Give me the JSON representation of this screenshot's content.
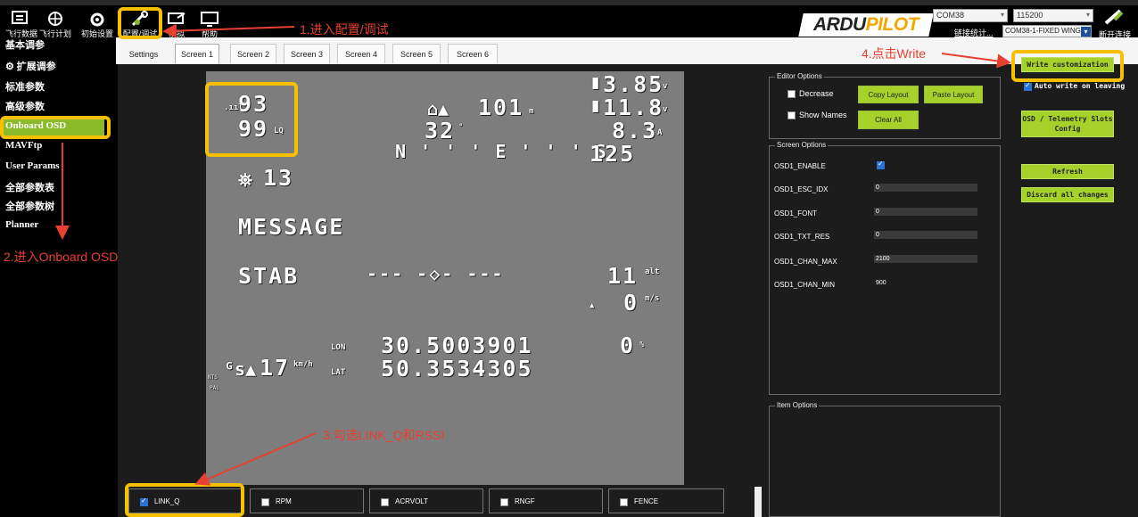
{
  "toolbar": {
    "items": [
      {
        "label": "飞行数据",
        "icon": "flight-data-icon"
      },
      {
        "label": "飞行计划",
        "icon": "flight-plan-icon"
      },
      {
        "label": "初始设置",
        "icon": "initial-setup-icon"
      },
      {
        "label": "配置/调试",
        "icon": "config-tuning-icon"
      },
      {
        "label": "模拟",
        "icon": "simulation-icon"
      },
      {
        "label": "帮助",
        "icon": "help-icon"
      }
    ],
    "logo_text_a": "ARDU",
    "logo_text_b": "PILOT",
    "port": "COM38",
    "baud": "115200",
    "link_stats": "链接统计...",
    "vehicle": "COM38-1-FIXED WING",
    "disconnect": "断开连接"
  },
  "sidebar": {
    "items": [
      "基本调参",
      "扩展调参",
      "标准参数",
      "高级参数",
      "Onboard OSD",
      "MAVFtp",
      "User Params",
      "全部参数表",
      "全部参数树",
      "Planner"
    ]
  },
  "tabs": [
    "Settings",
    "Screen 1",
    "Screen 2",
    "Screen 3",
    "Screen 4",
    "Screen 5",
    "Screen 6"
  ],
  "osd": {
    "rssi": "93",
    "link_q": "99",
    "batt1": "3.85",
    "batt1_unit": "v",
    "batt2": "11.8",
    "batt2_unit": "v",
    "home_dist": "101",
    "home_unit": "m",
    "heading": "32",
    "current": "8.3",
    "current_unit": "A",
    "compass": "N ' ' ' E ' ' ' S",
    "throttle": "125",
    "sats": "13",
    "message": "MESSAGE",
    "mode": "STAB",
    "horizon": "--- -◇- ---",
    "altitude": "11",
    "climb": "0",
    "lon_label": "LON",
    "lat_label": "LAT",
    "lon": "30.5003901",
    "lat": "50.3534305",
    "gspeed": "17",
    "throttle_pct": "0",
    "ntsc": "NTS",
    "pal": "PAL"
  },
  "editor": {
    "title": "Editor Options",
    "decrease": "Decrease",
    "show_names": "Show Names",
    "copy_layout": "Copy Layout",
    "paste_layout": "Paste Layout",
    "clear_all": "Clear All"
  },
  "screen_options": {
    "title": "Screen Options",
    "rows": [
      {
        "name": "OSD1_ENABLE",
        "value": ""
      },
      {
        "name": "OSD1_ESC_IDX",
        "value": "0"
      },
      {
        "name": "OSD1_FONT",
        "value": "0"
      },
      {
        "name": "OSD1_TXT_RES",
        "value": "0"
      },
      {
        "name": "OSD1_CHAN_MAX",
        "value": "2100"
      },
      {
        "name": "OSD1_CHAN_MIN",
        "value": "900"
      }
    ]
  },
  "item_options": {
    "title": "Item Options"
  },
  "right": {
    "write": "Write customization",
    "auto_write": "Auto write on leaving",
    "osd_slots": "OSD / Telemetry Slots Config",
    "refresh": "Refresh",
    "discard": "Discard all changes"
  },
  "items_row": [
    "LINK_Q",
    "RPM",
    "ACRVOLT",
    "RNGF",
    "FENCE"
  ],
  "annotations": {
    "step1": "1.进入配置/调试",
    "step2": "2.进入Onboard OSD",
    "step3": "3.勾选LINK_Q和RSSI",
    "step4": "4.点击Write"
  },
  "colors": {
    "accent_green": "#a5d12a",
    "annotation_red": "#e84030",
    "highlight_yellow": "#f6c000"
  }
}
